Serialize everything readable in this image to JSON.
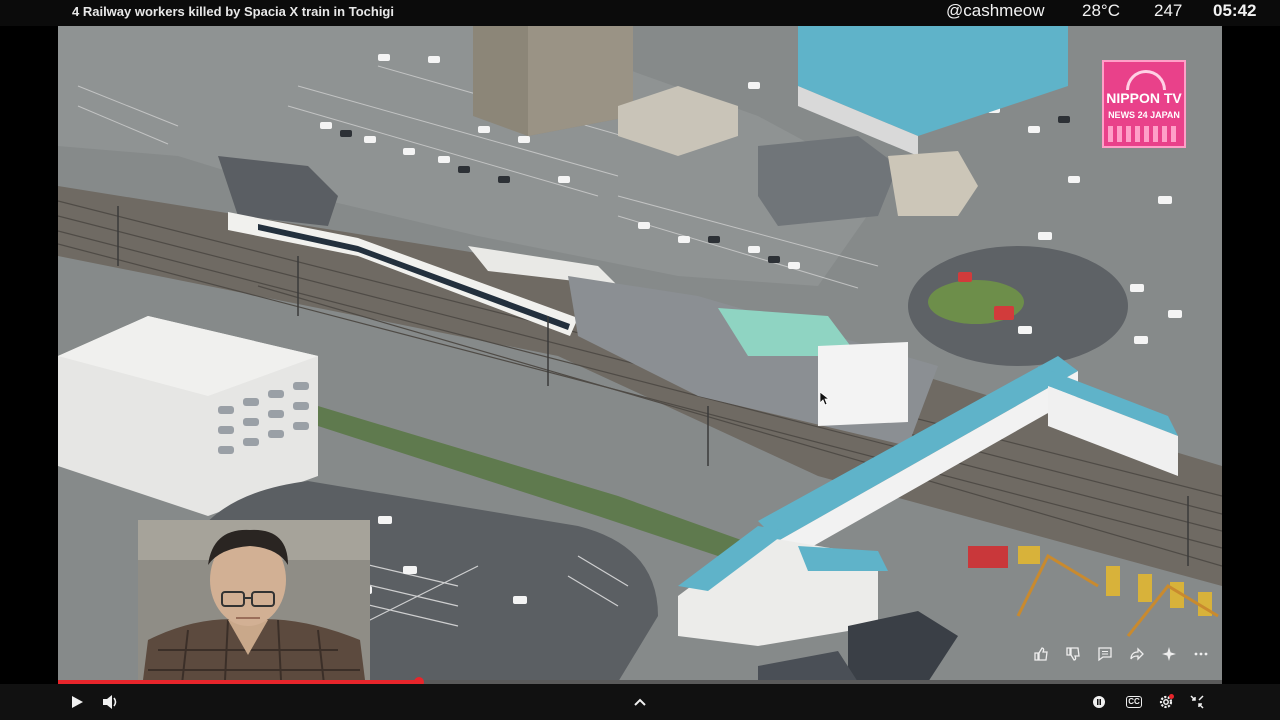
{
  "header": {
    "title": "4 Railway workers killed by Spacia X train in Tochigi"
  },
  "stream_stats": {
    "handle": "@cashmeow",
    "temperature": "28°C",
    "count": "247",
    "clock": "05:42"
  },
  "video": {
    "logo": {
      "main": "NIPPON TV",
      "sub": "NEWS 24 JAPAN"
    },
    "action_icons": [
      "thumbs-up-icon",
      "thumbs-down-icon",
      "comment-icon",
      "share-icon",
      "sparkle-icon",
      "more-icon"
    ],
    "progress_fraction": 0.31
  },
  "controls": {
    "cc_label": "CC"
  },
  "colors": {
    "accent": "#e8252b",
    "logo_pink": "#e9418a",
    "roof_teal": "#5fb3c9"
  }
}
